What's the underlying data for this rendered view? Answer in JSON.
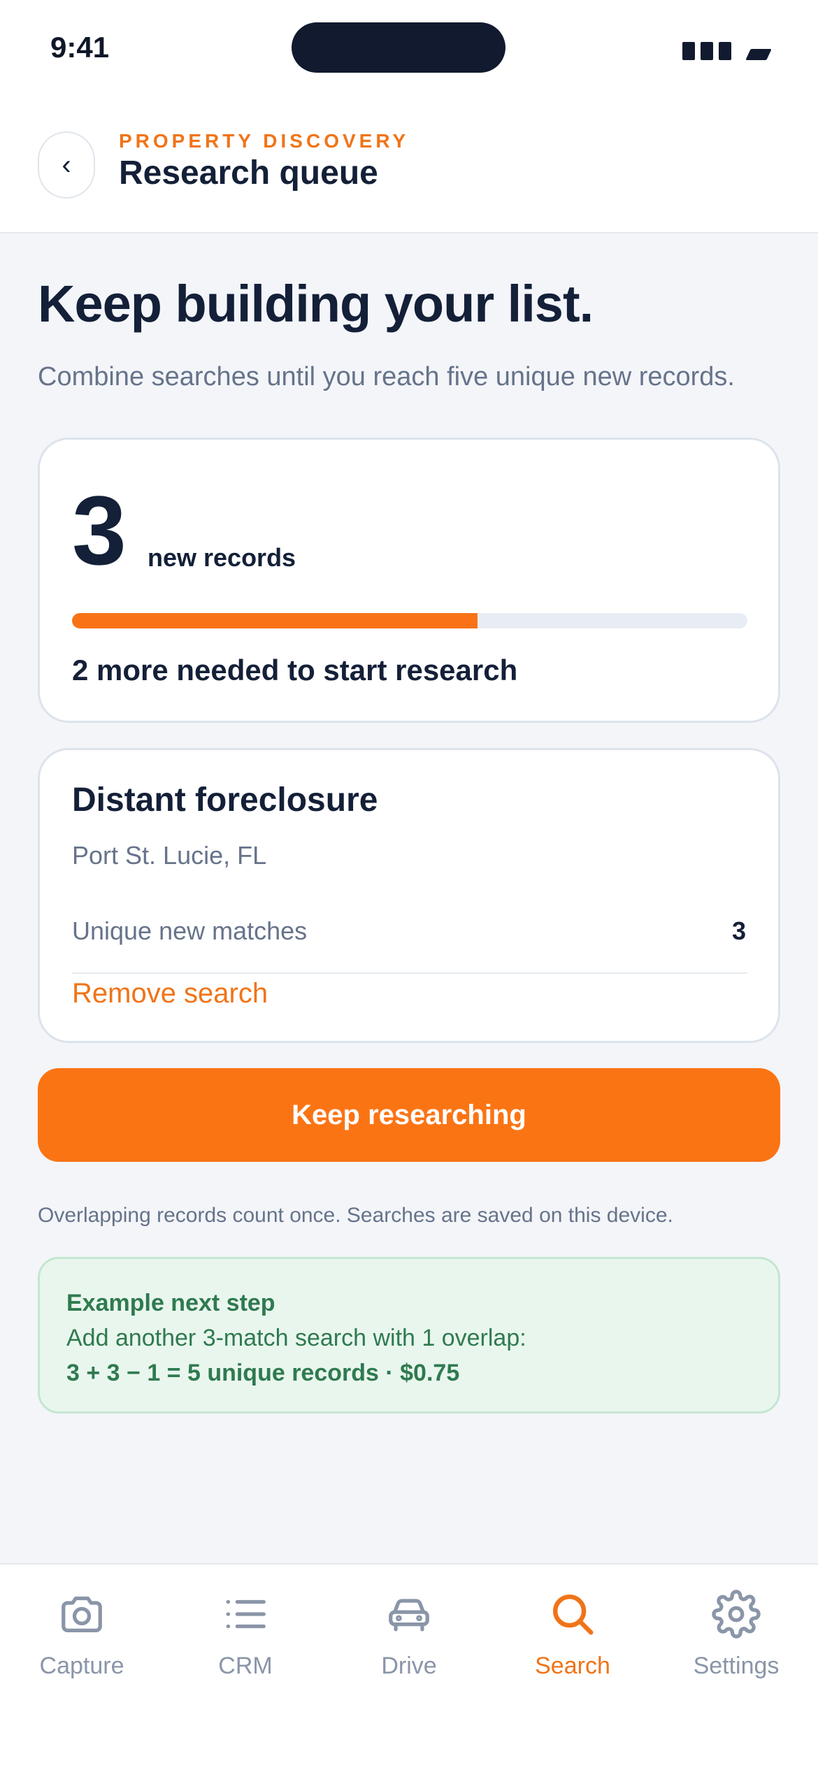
{
  "status_bar": {
    "time": "9:41"
  },
  "header": {
    "eyebrow": "PROPERTY DISCOVERY",
    "title": "Research queue",
    "back_glyph": "‹"
  },
  "main": {
    "headline": "Keep building your list.",
    "subhead": "Combine searches until you reach five unique new records."
  },
  "progress": {
    "count": "3",
    "count_label": "new records",
    "fraction": 0.6,
    "needed_text": "2 more needed to start research"
  },
  "search_card": {
    "title": "Distant foreclosure",
    "location": "Port St. Lucie, FL",
    "matches_label": "Unique new matches",
    "matches_value": "3",
    "remove_label": "Remove search"
  },
  "cta": {
    "label": "Keep researching"
  },
  "note": "Overlapping records count once. Searches are saved on this device.",
  "example": {
    "title": "Example next step",
    "body": "Add another 3-match search with 1 overlap:",
    "formula": "3 + 3 − 1 = 5 unique records · $0.75"
  },
  "tabs": [
    {
      "label": "Capture",
      "icon": "camera-icon"
    },
    {
      "label": "CRM",
      "icon": "list-icon"
    },
    {
      "label": "Drive",
      "icon": "car-icon"
    },
    {
      "label": "Search",
      "icon": "search-icon",
      "active": true
    },
    {
      "label": "Settings",
      "icon": "gear-icon"
    }
  ],
  "colors": {
    "accent": "#f97316",
    "text": "#142038",
    "muted": "#66738a",
    "success": "#2f7a4f",
    "tab_inactive": "#8a95a8"
  }
}
